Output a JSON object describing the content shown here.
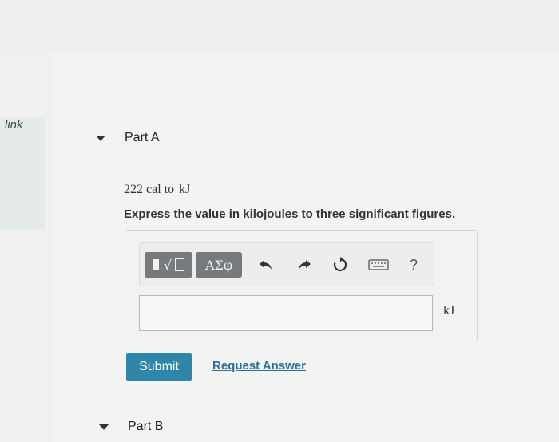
{
  "sidebar": {
    "link_label": "link"
  },
  "partA": {
    "label": "Part A"
  },
  "problem": {
    "text": "222 cal  to",
    "unit_text": "kJ"
  },
  "instruction": "Express the value in kilojoules to three significant figures.",
  "toolbar": {
    "templates_label": "√",
    "greek_label": "ΑΣφ",
    "undo_icon": "undo-icon",
    "redo_icon": "redo-icon",
    "reset_icon": "reset-icon",
    "keyboard_icon": "keyboard-icon",
    "help_label": "?"
  },
  "answer": {
    "value": "",
    "unit": "kJ"
  },
  "actions": {
    "submit_label": "Submit",
    "request_label": "Request Answer"
  },
  "partB": {
    "label": "Part B"
  },
  "colors": {
    "submit_bg": "#2f86a8",
    "link": "#2a6f93",
    "toolbar_dark": "#767a7c"
  }
}
